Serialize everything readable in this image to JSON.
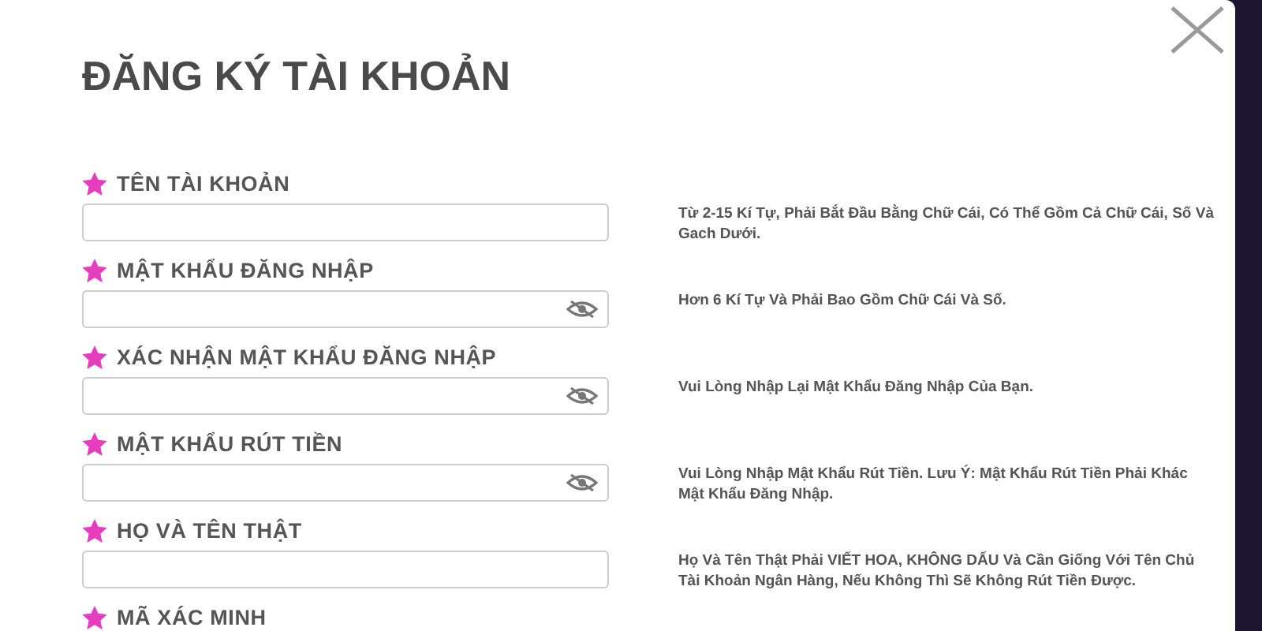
{
  "dialog": {
    "title": "ĐĂNG KÝ TÀI KHOẢN"
  },
  "fields": [
    {
      "label": "TÊN TÀI KHOẢN",
      "kind": "text",
      "hint": "Từ 2-15 Kí Tự, Phải Bắt Đầu Bằng Chữ Cái, Có Thể Gồm Cả Chữ Cái, Số Và Gach Dưới."
    },
    {
      "label": "MẬT KHẨU ĐĂNG NHẬP",
      "kind": "password",
      "hint": "Hơn 6 Kí Tự Và Phải Bao Gồm Chữ Cái Và Số."
    },
    {
      "label": "XÁC NHẬN MẬT KHẨU ĐĂNG NHẬP",
      "kind": "password",
      "hint": "Vui Lòng Nhập Lại Mật Khẩu Đăng Nhập Của Bạn."
    },
    {
      "label": "MẬT KHẨU RÚT TIỀN",
      "kind": "password",
      "hint": "Vui Lòng Nhập Mật Khẩu Rút Tiền. Lưu Ý: Mật Khẩu Rút Tiền Phải Khác Mật Khẩu Đăng Nhập."
    },
    {
      "label": "HỌ VÀ TÊN THẬT",
      "kind": "text",
      "hint": "Họ Và Tên Thật Phải VIẾT HOA, KHÔNG DẤU Và Cần Giống Với Tên Chủ Tài Khoản Ngân Hàng, Nếu Không Thì Sẽ Không Rút Tiền Được."
    },
    {
      "label": "MÃ XÁC MINH",
      "kind": "label_only"
    }
  ]
}
